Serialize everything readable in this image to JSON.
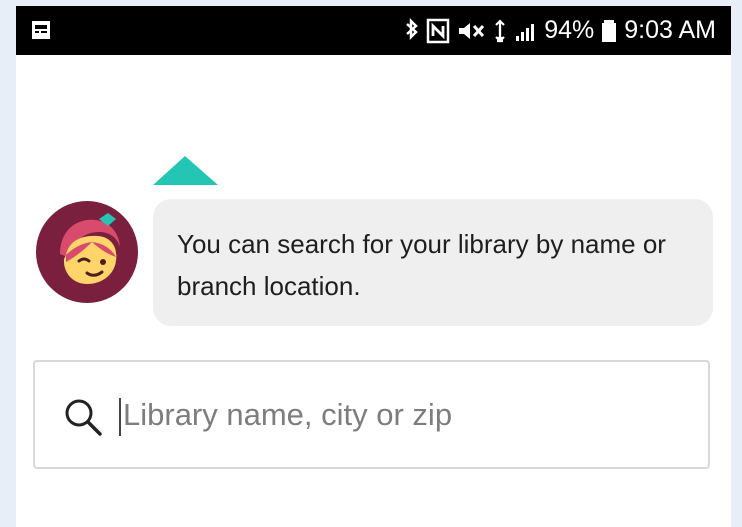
{
  "status_bar": {
    "battery": "94%",
    "time": "9:03 AM"
  },
  "icons": {
    "screen_indicator": "screen-icon",
    "bluetooth": "bluetooth-icon",
    "nfc": "nfc-icon",
    "mute": "mute-icon",
    "data": "data-icon",
    "signal": "signal-icon",
    "battery": "battery-icon",
    "avatar": "avatar-icon",
    "search": "search-icon"
  },
  "message": {
    "text": "You can search for your library by name or branch location."
  },
  "search": {
    "placeholder": "Library name, city or zip"
  },
  "colors": {
    "teal_accent": "#25c5b6",
    "avatar_bg": "#7a1f3d",
    "bubble_bg": "#efefef"
  }
}
